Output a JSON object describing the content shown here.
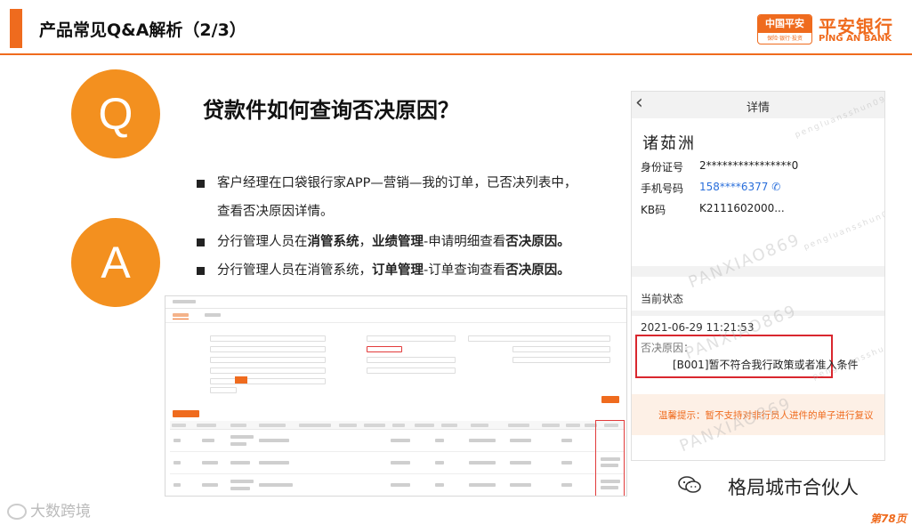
{
  "header": {
    "title": "产品常见Q&A解析（2/3）",
    "logo_box_top": "中国平安",
    "logo_box_bottom": "保险·银行·投资",
    "logo_cn": "平安银行",
    "logo_en": "PING AN BANK"
  },
  "qa": {
    "q_letter": "Q",
    "a_letter": "A",
    "question": "贷款件如何查询否决原因？",
    "bullets": [
      {
        "line1": "客户经理在口袋银行家APP—营销—我的订单，已否决列表中，",
        "line2": "查看否决原因详情。"
      },
      {
        "pre": "分行管理人员在",
        "bold1": "消管系统",
        "mid": "，",
        "bold2": "业绩管理",
        "post": "-申请明细查看",
        "bold3": "否决原因。"
      },
      {
        "pre": "分行管理人员在消管系统，",
        "bold1": "订单管理",
        "post": "-订单查询查看",
        "bold2": "否决原因。"
      }
    ]
  },
  "phone": {
    "back_icon": "chevron-left-icon",
    "nav_title": "详情",
    "name": "诸茹洲",
    "id_label": "身份证号",
    "id_value": "2****************0",
    "phone_label": "手机号码",
    "phone_value": "158****6377",
    "phone_icon": "phone-icon",
    "kb_label": "KB码",
    "kb_value": "K2111602000...",
    "status_section": "当前状态",
    "status_time": "2021-06-29 11:21:53",
    "reason_label": "否决原因：",
    "reason_text": "[B001]暂不符合我行政策或者准入条件",
    "tip": "温馨提示：暂不支持对非行员人进件的单子进行复议",
    "watermark": "PANXIAO869",
    "watermark_small": "pengluansshun09"
  },
  "footer": {
    "wechat_label": "格局城市合伙人",
    "corner_logo": "大数跨境",
    "page": "第78页"
  },
  "colors": {
    "brand_orange": "#ef6b1e",
    "circle_orange": "#f3901f",
    "highlight_red": "#d9272e",
    "link_blue": "#2a6fdb"
  }
}
